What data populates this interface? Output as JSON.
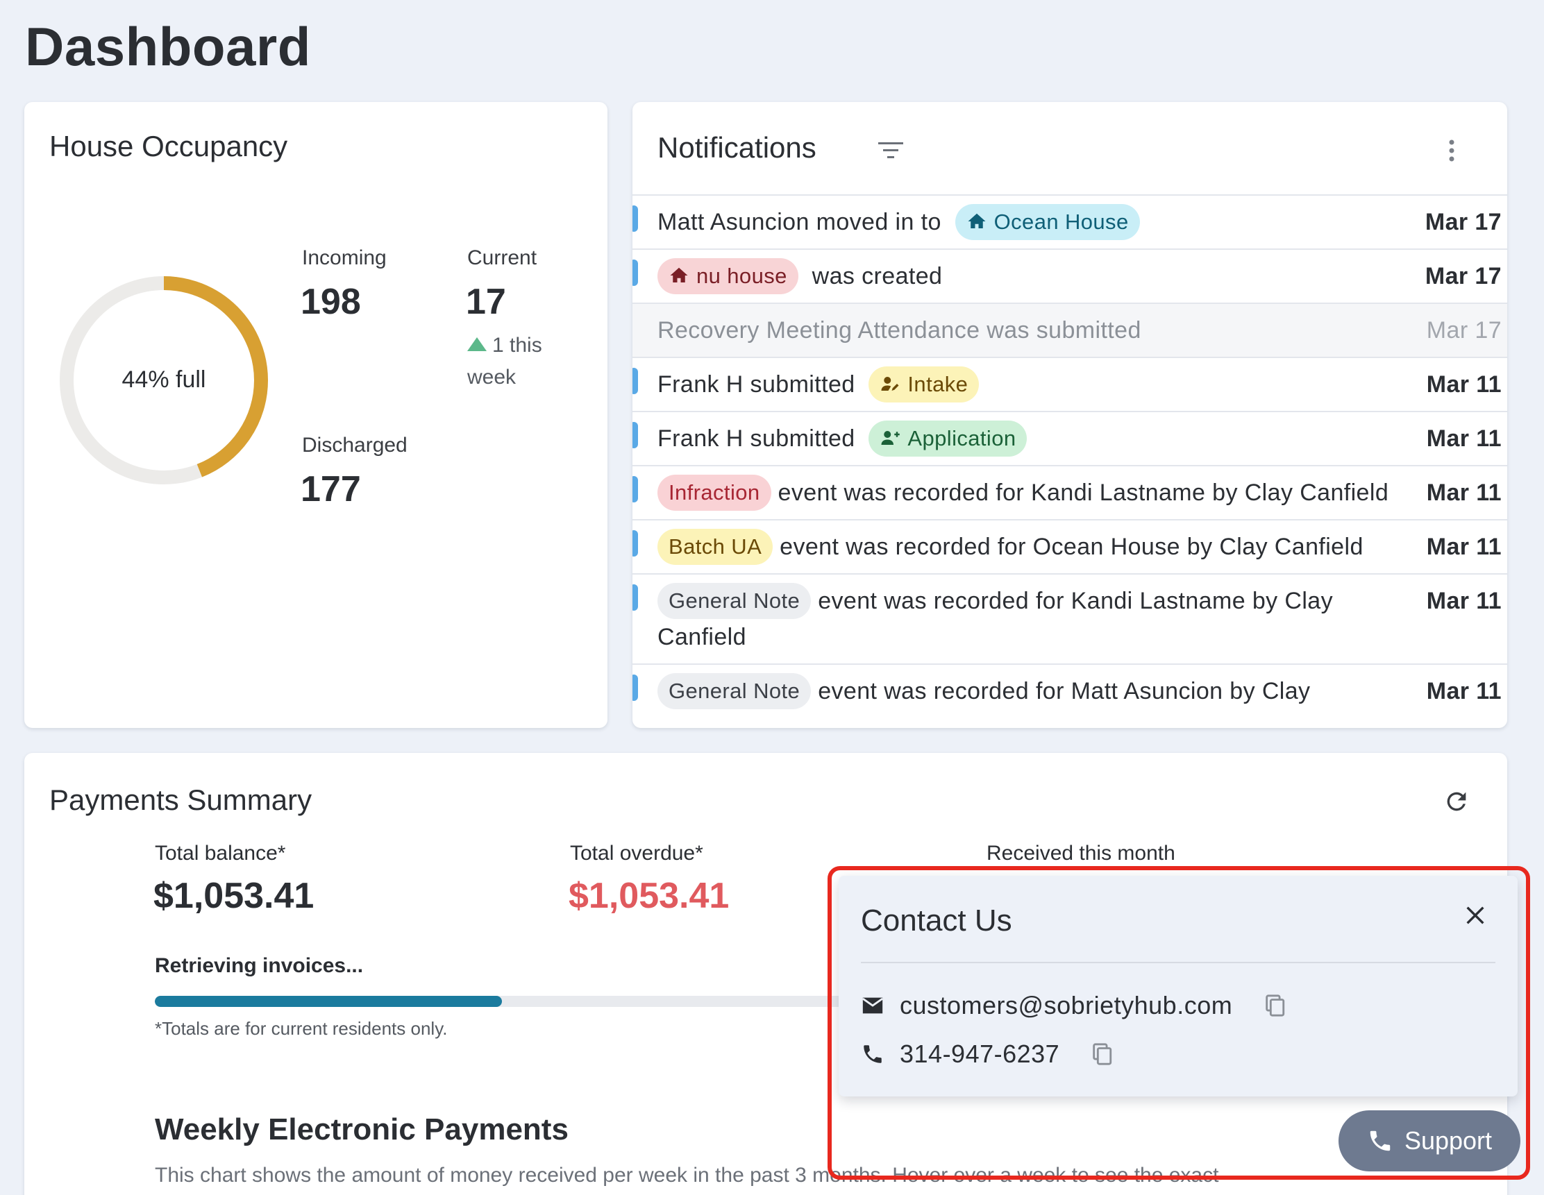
{
  "page": {
    "title": "Dashboard"
  },
  "occupancy": {
    "title": "House Occupancy",
    "percent_full": 44,
    "donut_label": "44% full",
    "colors": {
      "fill": "#d8a032",
      "track": "#ecebe9"
    },
    "incoming": {
      "label": "Incoming",
      "value": "198"
    },
    "current": {
      "label": "Current",
      "value": "17",
      "delta": "1 this week"
    },
    "discharged": {
      "label": "Discharged",
      "value": "177"
    }
  },
  "notifications": {
    "title": "Notifications",
    "filter_icon": "filter-icon",
    "more_icon": "more-vert-icon",
    "items": [
      {
        "before": "Matt Asuncion moved in to",
        "chip": "Ocean House",
        "chip_icon": "home-icon",
        "after": "",
        "date": "Mar 17"
      },
      {
        "before": "",
        "chip": "nu house",
        "chip_icon": "home-icon",
        "after": "was created",
        "date": "Mar 17"
      },
      {
        "text": "Recovery Meeting Attendance was submitted",
        "date": "Mar 17"
      },
      {
        "before": "Frank H submitted",
        "chip": "Intake",
        "chip_icon": "person-edit-icon",
        "date": "Mar 11"
      },
      {
        "before": "Frank H submitted",
        "chip": "Application",
        "chip_icon": "person-add-icon",
        "date": "Mar 11"
      },
      {
        "chip": "Infraction",
        "after": "event was recorded for Kandi Lastname by Clay Canfield",
        "date": "Mar 11"
      },
      {
        "chip": "Batch UA",
        "after": "event was recorded for Ocean House by Clay Canfield",
        "date": "Mar 11"
      },
      {
        "chip": "General Note",
        "after": "event was recorded for Kandi Lastname by Clay Canfield",
        "date": "Mar 11"
      },
      {
        "chip": "General Note",
        "after": "event was recorded for Matt Asuncion by Clay",
        "date": "Mar 11"
      }
    ]
  },
  "payments": {
    "title": "Payments Summary",
    "refresh_icon": "refresh-icon",
    "total_balance": {
      "label": "Total balance*",
      "value": "$1,053.41"
    },
    "total_overdue": {
      "label": "Total overdue*",
      "value": "$1,053.41",
      "color": "#e05a5e"
    },
    "received": {
      "label": "Received this month"
    },
    "retrieving": "Retrieving invoices...",
    "progress_percent": 50,
    "footnote": "*Totals are for current residents only.",
    "weekly_title": "Weekly Electronic Payments",
    "weekly_desc": "This chart shows the amount of money received per week in the past 3 months. Hover over a week to see the exact"
  },
  "contact": {
    "title": "Contact Us",
    "email": "customers@sobrietyhub.com",
    "phone": "314-947-6237"
  },
  "support": {
    "label": "Support"
  }
}
